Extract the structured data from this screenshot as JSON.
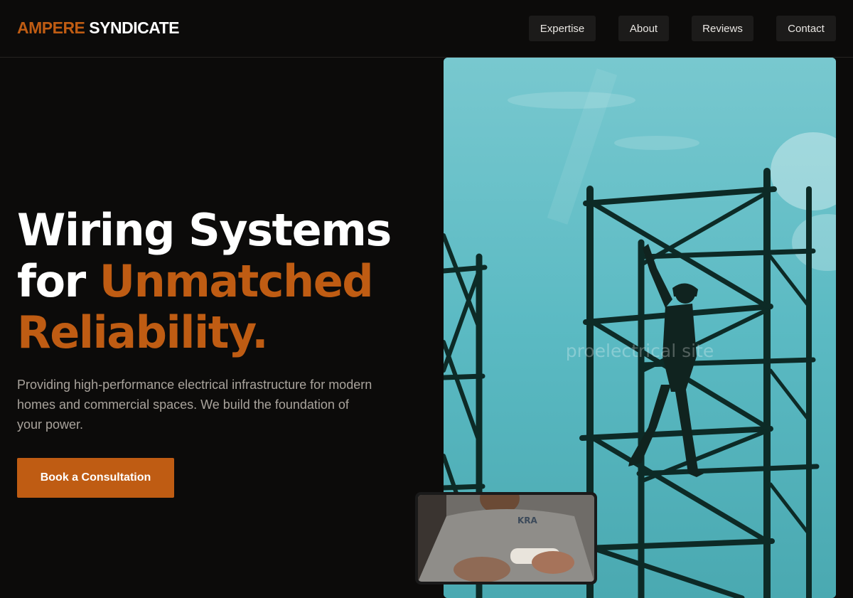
{
  "brand": {
    "accent": "AMPERE",
    "main": "SYNDICATE"
  },
  "nav": {
    "items": [
      {
        "label": "Expertise"
      },
      {
        "label": "About"
      },
      {
        "label": "Reviews"
      },
      {
        "label": "Contact"
      }
    ]
  },
  "hero": {
    "title_line1": "Wiring Systems",
    "title_line2_plain": "for ",
    "title_line2_accent": "Unmatched",
    "title_line3_accent": "Reliability.",
    "subtitle": "Providing high-performance electrical infrastructure for modern homes and commercial spaces. We build the foundation of your power.",
    "cta_label": "Book a Consultation"
  },
  "images": {
    "main_watermark": "proelectrical site",
    "main_subject": "worker-on-scaffolding",
    "inset_subject": "electrician-portrait"
  },
  "colors": {
    "background": "#0c0b0a",
    "accent": "#bf5c13",
    "nav_button": "#1c1b1a",
    "subtitle": "#a9a39c",
    "sky": "#55b7c0"
  }
}
